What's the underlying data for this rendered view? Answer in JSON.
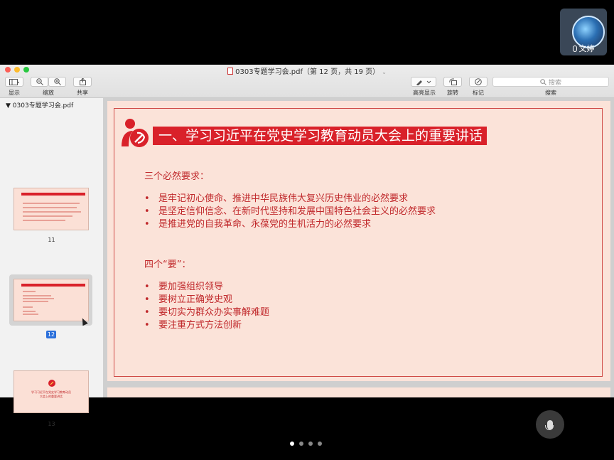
{
  "participant": {
    "name": "文婷"
  },
  "window": {
    "title": "0303专题学习会.pdf（第 12 页，共 19 页）",
    "toolbar": {
      "view_label": "显示",
      "zoom_label": "缩放",
      "share_label": "共享",
      "highlight_label": "高亮显示",
      "rotate_label": "旋转",
      "markup_label": "标记",
      "search_label": "搜索",
      "search_placeholder": "搜索"
    }
  },
  "sidebar": {
    "file_name": "0303专题学习会.pdf",
    "pages": [
      {
        "number": "11",
        "selected": false
      },
      {
        "number": "12",
        "selected": true
      },
      {
        "number": "13",
        "selected": false
      }
    ],
    "thumb13_text": [
      "学习习近平在党史学习教育动员",
      "大会上的重要讲话"
    ]
  },
  "slide": {
    "title": "一、学习习近平在党史学习教育动员大会上的重要讲话",
    "section1": {
      "heading": "三个必然要求：",
      "items": [
        "是牢记初心使命、推进中华民族伟大复兴历史伟业的必然要求",
        "是坚定信仰信念、在新时代坚持和发展中国特色社会主义的必然要求",
        "是推进党的自我革命、永葆党的生机活力的必然要求"
      ]
    },
    "section2": {
      "heading": "四个“要”：",
      "items": [
        "要加强组织领导",
        "要树立正确党史观",
        "要切实为群众办实事解难题",
        "要注重方式方法创新"
      ]
    }
  },
  "colors": {
    "accent_red": "#d9212a",
    "slide_bg": "#fbe3d9",
    "text_red": "#c0282b"
  },
  "meeting": {
    "page_dots": 4,
    "active_dot": 1
  }
}
